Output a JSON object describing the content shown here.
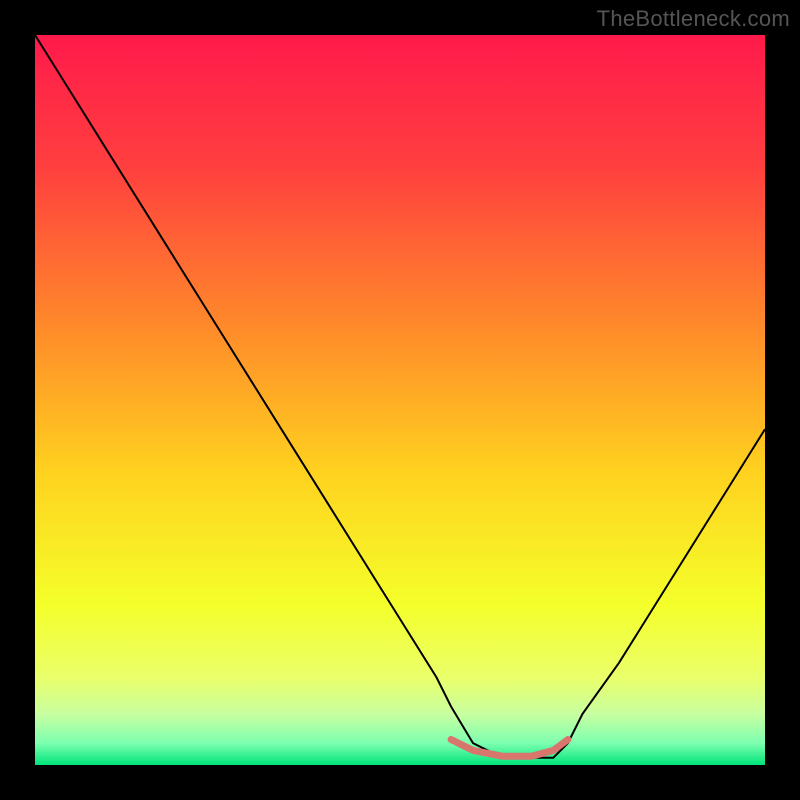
{
  "watermark": "TheBottleneck.com",
  "chart_data": {
    "type": "line",
    "title": "",
    "xlabel": "",
    "ylabel": "",
    "xlim": [
      0,
      100
    ],
    "ylim": [
      0,
      100
    ],
    "series": [
      {
        "name": "bottleneck-curve",
        "color": "#000000",
        "stroke_width": 2,
        "x": [
          0,
          5,
          10,
          15,
          20,
          25,
          30,
          35,
          40,
          45,
          50,
          55,
          57,
          60,
          64,
          68,
          71,
          73,
          75,
          80,
          85,
          90,
          95,
          100
        ],
        "y": [
          100,
          92,
          84,
          76,
          68,
          60,
          52,
          44,
          36,
          28,
          20,
          12,
          8,
          3,
          1,
          1,
          1,
          3,
          7,
          14,
          22,
          30,
          38,
          46
        ]
      },
      {
        "name": "optimal-band",
        "color": "#d8766d",
        "stroke_width": 7,
        "linecap": "round",
        "x": [
          57,
          60,
          64,
          68,
          71,
          73
        ],
        "y": [
          3.5,
          2.0,
          1.2,
          1.2,
          2.0,
          3.5
        ]
      }
    ],
    "gradient": [
      {
        "pct": 0,
        "color": "#ff1a4b"
      },
      {
        "pct": 18,
        "color": "#ff3f3f"
      },
      {
        "pct": 40,
        "color": "#ff8a2a"
      },
      {
        "pct": 60,
        "color": "#ffd21f"
      },
      {
        "pct": 78,
        "color": "#f4ff2a"
      },
      {
        "pct": 88,
        "color": "#eaff6a"
      },
      {
        "pct": 93,
        "color": "#c8ffa0"
      },
      {
        "pct": 97,
        "color": "#7dffb0"
      },
      {
        "pct": 100,
        "color": "#00e47a"
      }
    ]
  }
}
